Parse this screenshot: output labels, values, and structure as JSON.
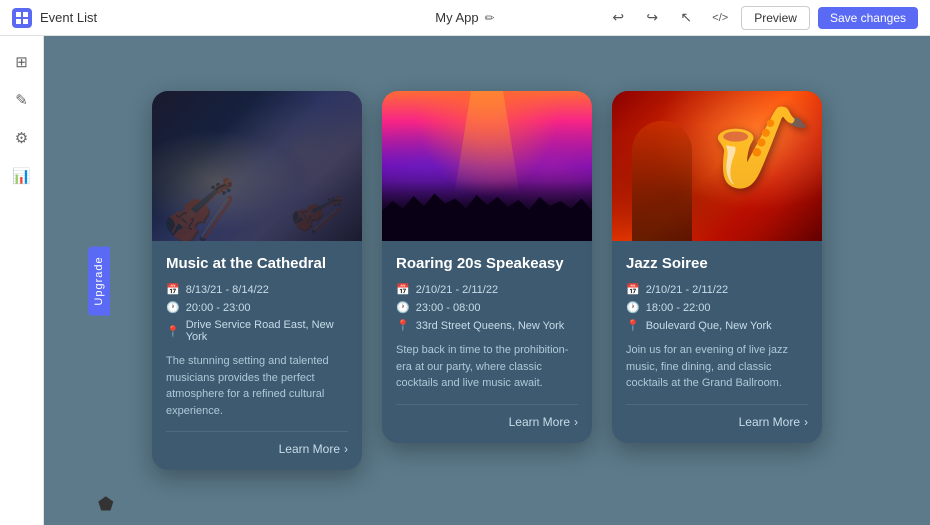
{
  "topbar": {
    "logo_label": "Event List",
    "app_name": "My App",
    "edit_icon": "✏",
    "preview_label": "Preview",
    "save_label": "Save changes",
    "undo_icon": "↩",
    "redo_icon": "↪",
    "cursor_icon": "↖",
    "code_icon": "</>",
    "icons": [
      "↩",
      "↪",
      "↖",
      "</>"
    ]
  },
  "sidebar": {
    "icons": [
      "⊞",
      "✎",
      "⚙",
      "📊"
    ]
  },
  "upgrade": {
    "label": "Upgrade"
  },
  "cards": [
    {
      "title": "Music at the Cathedral",
      "date": "8/13/21 - 8/14/22",
      "time": "20:00 - 23:00",
      "location": "Drive Service Road East, New York",
      "description": "The stunning setting and talented musicians provides the perfect atmosphere for a refined cultural experience.",
      "learn_more": "Learn More",
      "image_type": "orchestra"
    },
    {
      "title": "Roaring 20s Speakeasy",
      "date": "2/10/21 - 2/11/22",
      "time": "23:00 - 08:00",
      "location": "33rd Street Queens, New York",
      "description": "Step back in time to the prohibition-era at our party, where classic cocktails and live music await.",
      "learn_more": "Learn More",
      "image_type": "concert"
    },
    {
      "title": "Jazz Soiree",
      "date": "2/10/21 - 2/11/22",
      "time": "18:00 - 22:00",
      "location": "Boulevard Que, New York",
      "description": "Join us for an evening of live jazz music, fine dining, and classic cocktails at the Grand Ballroom.",
      "learn_more": "Learn More",
      "image_type": "jazz"
    }
  ]
}
